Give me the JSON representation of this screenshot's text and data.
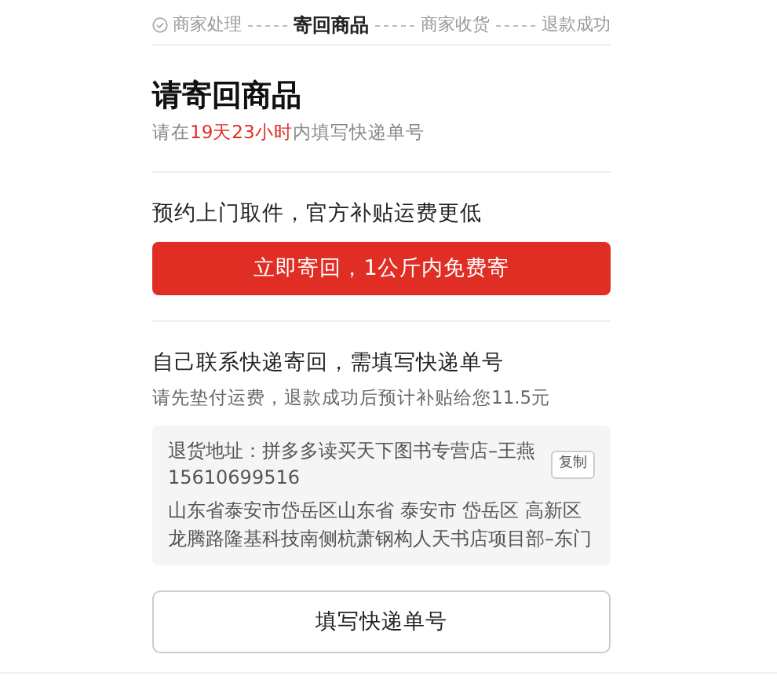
{
  "steps": [
    {
      "label": "商家处理",
      "done": true,
      "selected": false
    },
    {
      "label": "寄回商品",
      "done": false,
      "selected": true
    },
    {
      "label": "商家收货",
      "done": false,
      "selected": false
    },
    {
      "label": "退款成功",
      "done": false,
      "selected": false
    }
  ],
  "title": "请寄回商品",
  "deadline": {
    "before": "请在",
    "highlight": "19天23小时",
    "after": "内填写快递单号"
  },
  "pickup": {
    "heading": "预约上门取件，官方补贴运费更低",
    "button": "立即寄回，1公斤内免费寄"
  },
  "self_send": {
    "heading": "自己联系快递寄回，需填写快递单号",
    "note": "请先垫付运费，退款成功后预计补贴给您11.5元",
    "address_contact": "退货地址：拼多多读买天下图书专营店–王燕 15610699516",
    "copy_button": "复制",
    "address": "山东省泰安市岱岳区山东省 泰安市 岱岳区 高新区龙腾路隆基科技南侧杭萧钢构人天书店项目部–东门",
    "button": "填写快递单号"
  }
}
